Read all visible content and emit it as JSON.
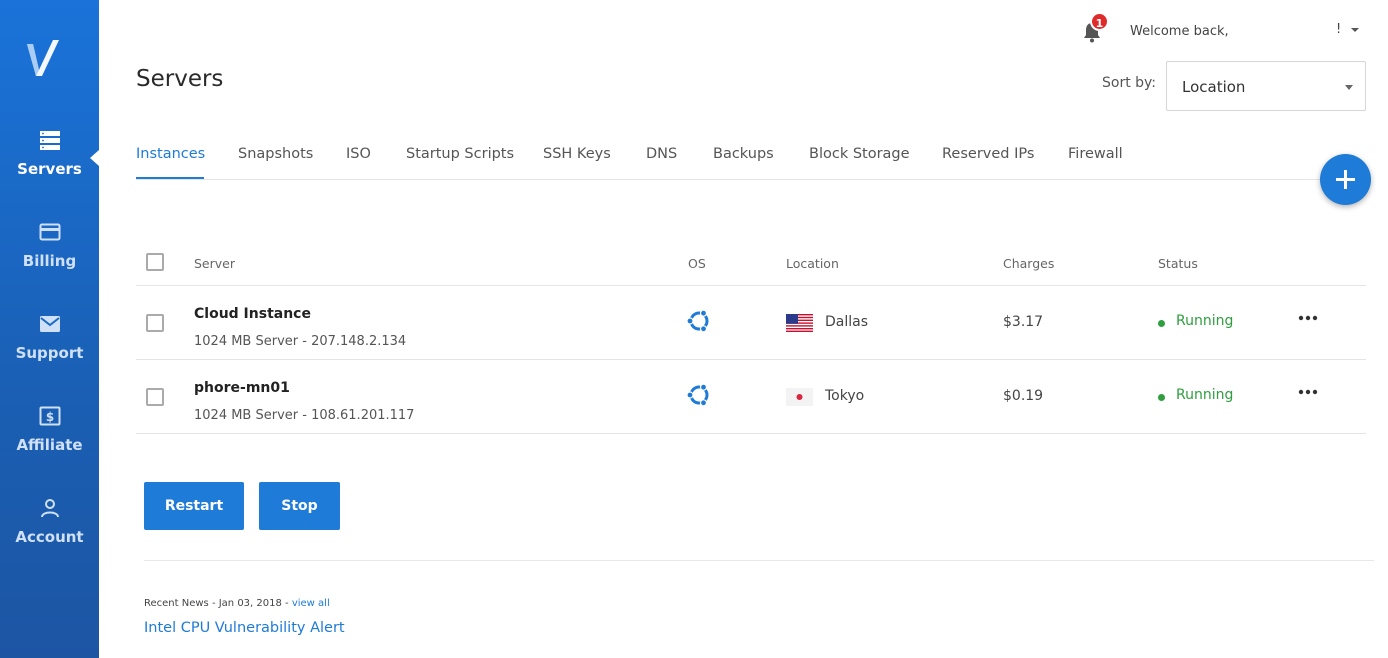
{
  "app": {
    "brand_color": "#1e7bd7",
    "sidebar_color": "#1a6ac8"
  },
  "sidebar": {
    "items": [
      {
        "label": "Servers",
        "icon": "servers-icon",
        "active": true
      },
      {
        "label": "Billing",
        "icon": "credit-card-icon",
        "active": false
      },
      {
        "label": "Support",
        "icon": "envelope-icon",
        "active": false
      },
      {
        "label": "Affiliate",
        "icon": "dollar-icon",
        "active": false
      },
      {
        "label": "Account",
        "icon": "user-icon",
        "active": false
      }
    ]
  },
  "header": {
    "notification_count": "1",
    "welcome_text": "Welcome back,",
    "user_name": "!"
  },
  "page": {
    "title": "Servers",
    "sort_label": "Sort by:",
    "sort_value": "Location"
  },
  "tabs": [
    {
      "label": "Instances",
      "active": true
    },
    {
      "label": "Snapshots"
    },
    {
      "label": "ISO"
    },
    {
      "label": "Startup Scripts"
    },
    {
      "label": "SSH Keys"
    },
    {
      "label": "DNS"
    },
    {
      "label": "Backups"
    },
    {
      "label": "Block Storage"
    },
    {
      "label": "Reserved IPs"
    },
    {
      "label": "Firewall"
    }
  ],
  "table": {
    "columns": {
      "server": "Server",
      "os": "OS",
      "location": "Location",
      "charges": "Charges",
      "status": "Status"
    },
    "rows": [
      {
        "name": "Cloud Instance",
        "details": "1024 MB Server - 207.148.2.134",
        "os_icon": "ubuntu-icon",
        "flag": "us-flag-icon",
        "location": "Dallas",
        "charges": "$3.17",
        "status": "Running"
      },
      {
        "name": "phore-mn01",
        "details": "1024 MB Server - 108.61.201.117",
        "os_icon": "ubuntu-icon",
        "flag": "jp-flag-icon",
        "location": "Tokyo",
        "charges": "$0.19",
        "status": "Running"
      }
    ]
  },
  "actions": {
    "restart_label": "Restart",
    "stop_label": "Stop"
  },
  "news": {
    "meta": "Recent News - Jan 03, 2018 - ",
    "view_all": "view all",
    "title": "Intel CPU Vulnerability Alert"
  }
}
